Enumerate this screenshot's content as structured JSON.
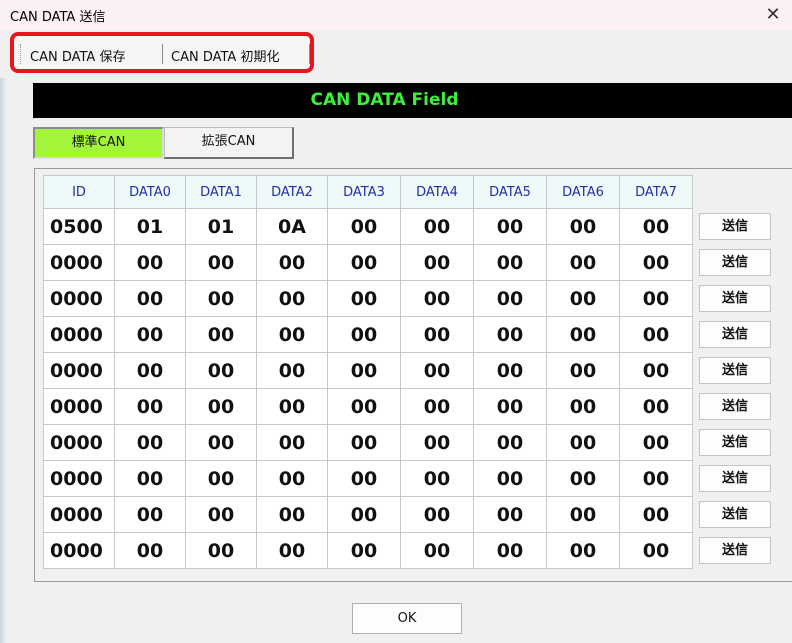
{
  "window": {
    "title": "CAN DATA 送信",
    "close_glyph": "✕"
  },
  "menu": {
    "items": [
      "CAN DATA 保存",
      "CAN DATA 初期化"
    ],
    "highlight_color": "#e8151d"
  },
  "field_banner": {
    "text": "CAN DATA Field",
    "text_color": "#3cf03c",
    "bg_color": "#000000"
  },
  "tabs": [
    {
      "label": "標準CAN",
      "selected": true,
      "color": "#a3f53a"
    },
    {
      "label": "拡張CAN",
      "selected": false
    }
  ],
  "table": {
    "headers": [
      "ID",
      "DATA0",
      "DATA1",
      "DATA2",
      "DATA3",
      "DATA4",
      "DATA5",
      "DATA6",
      "DATA7"
    ],
    "rows": [
      [
        "0500",
        "01",
        "01",
        "0A",
        "00",
        "00",
        "00",
        "00",
        "00"
      ],
      [
        "0000",
        "00",
        "00",
        "00",
        "00",
        "00",
        "00",
        "00",
        "00"
      ],
      [
        "0000",
        "00",
        "00",
        "00",
        "00",
        "00",
        "00",
        "00",
        "00"
      ],
      [
        "0000",
        "00",
        "00",
        "00",
        "00",
        "00",
        "00",
        "00",
        "00"
      ],
      [
        "0000",
        "00",
        "00",
        "00",
        "00",
        "00",
        "00",
        "00",
        "00"
      ],
      [
        "0000",
        "00",
        "00",
        "00",
        "00",
        "00",
        "00",
        "00",
        "00"
      ],
      [
        "0000",
        "00",
        "00",
        "00",
        "00",
        "00",
        "00",
        "00",
        "00"
      ],
      [
        "0000",
        "00",
        "00",
        "00",
        "00",
        "00",
        "00",
        "00",
        "00"
      ],
      [
        "0000",
        "00",
        "00",
        "00",
        "00",
        "00",
        "00",
        "00",
        "00"
      ],
      [
        "0000",
        "00",
        "00",
        "00",
        "00",
        "00",
        "00",
        "00",
        "00"
      ]
    ],
    "send_label": "送信"
  },
  "ok_label": "OK"
}
